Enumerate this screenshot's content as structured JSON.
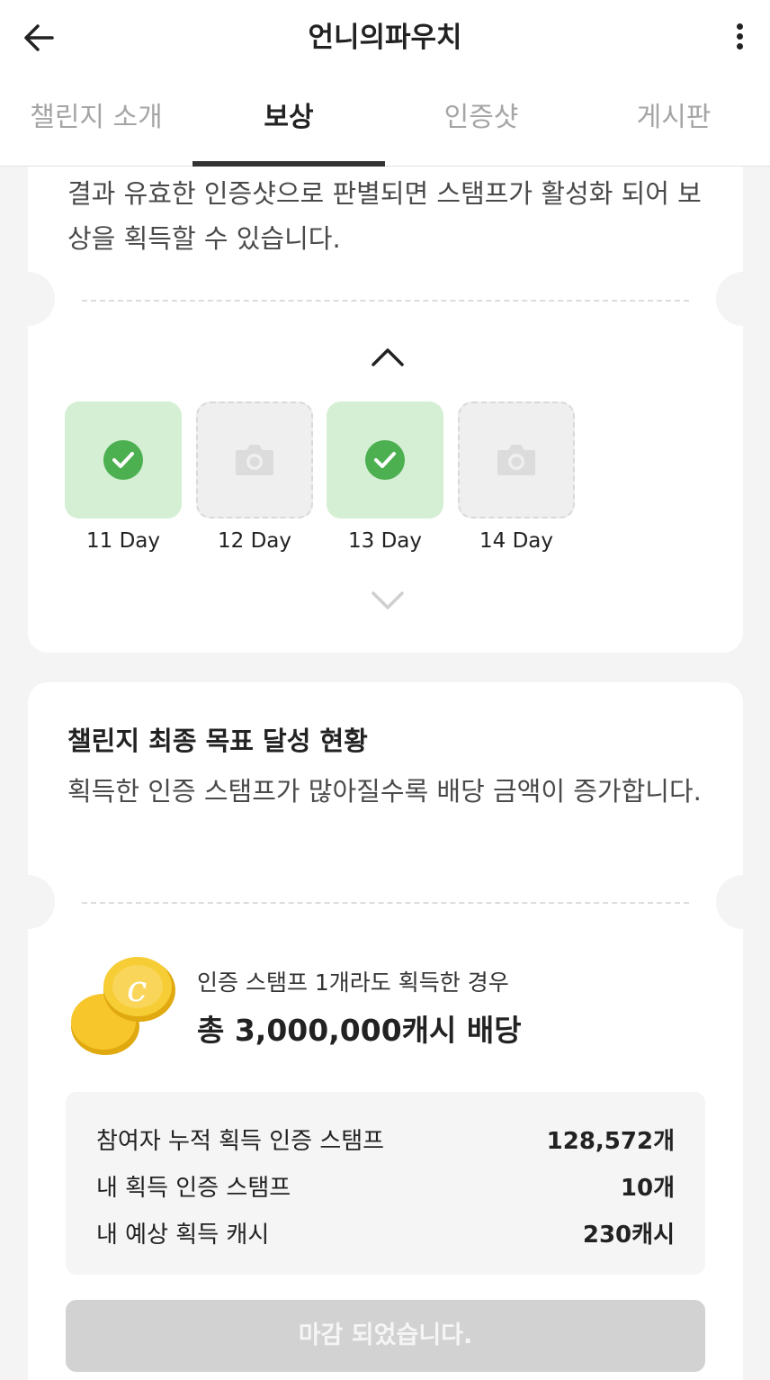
{
  "header": {
    "title": "언니의파우치",
    "tabs": [
      {
        "label": "챌린지 소개"
      },
      {
        "label": "보상"
      },
      {
        "label": "인증샷"
      },
      {
        "label": "게시판"
      }
    ],
    "active_tab": "보상"
  },
  "stamp_card": {
    "description": "결과 유효한 인증샷으로 판별되면 스탬프가 활성화 되어 보상을 획득할 수 있습니다.",
    "days": [
      {
        "label": "11 Day",
        "status": "verified",
        "icon": "check-circle-icon"
      },
      {
        "label": "12 Day",
        "status": "empty",
        "icon": "camera-icon"
      },
      {
        "label": "13 Day",
        "status": "verified",
        "icon": "check-circle-icon"
      },
      {
        "label": "14 Day",
        "status": "empty",
        "icon": "camera-icon"
      }
    ]
  },
  "goal_card": {
    "title": "챌린지 최종 목표 달성 현황",
    "description": "획득한 인증 스탬프가 많아질수록 배당 금액이 증가합니다.",
    "prize_condition": "인증 스탬프 1개라도 획득한 경우",
    "prize_total": "총 3,000,000캐시 배당",
    "stats": [
      {
        "label": "참여자 누적 획득 인증 스탬프",
        "value": "128,572개"
      },
      {
        "label": "내 획득 인증 스탬프",
        "value": "10개"
      },
      {
        "label": "내 예상 획득 캐시",
        "value": "230캐시"
      }
    ],
    "closed_button": "마감 되었습니다."
  },
  "colors": {
    "accent_green": "#4caf50",
    "verified_bg": "#d4efd3",
    "coin_gold": "#f2c230"
  }
}
